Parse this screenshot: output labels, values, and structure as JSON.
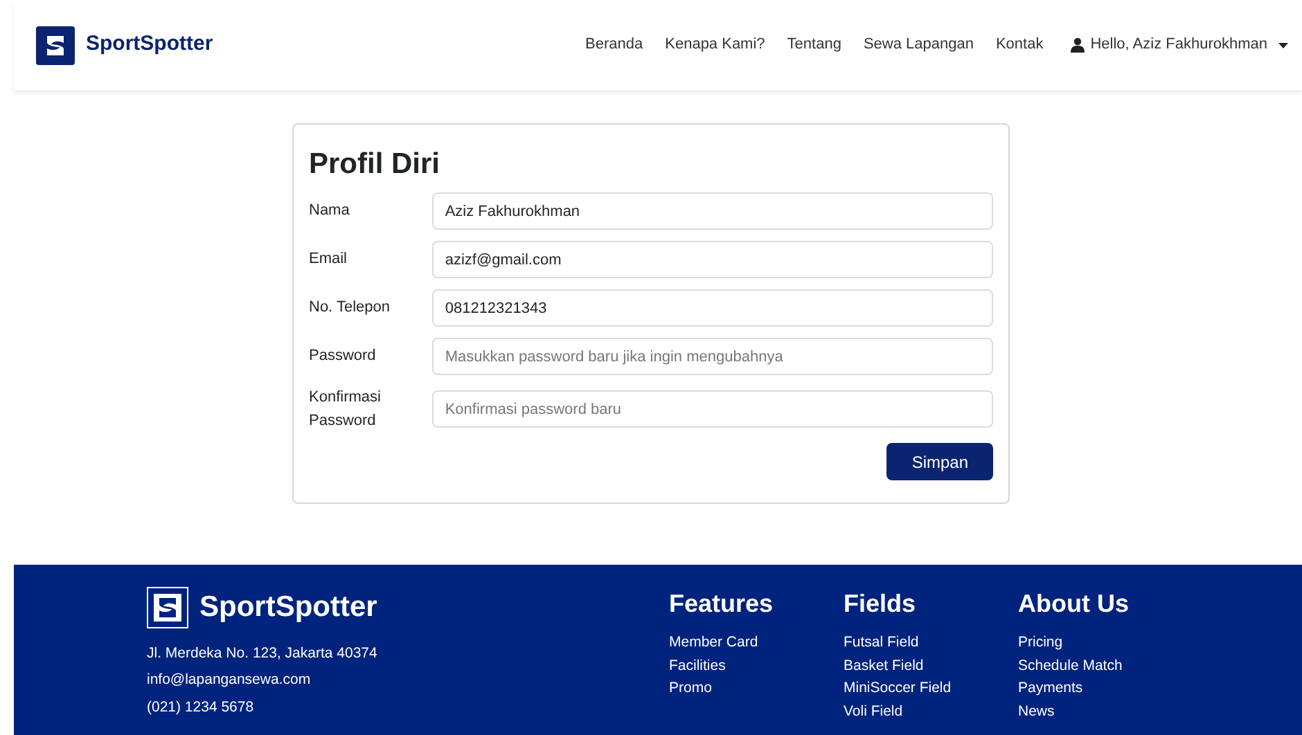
{
  "navbar": {
    "brand": "SportSpotter",
    "links": [
      "Beranda",
      "Kenapa Kami?",
      "Tentang",
      "Sewa Lapangan",
      "Kontak"
    ],
    "user_menu": "Hello, Aziz Fakhurokhman"
  },
  "profile": {
    "title": "Profil Diri",
    "fields": [
      {
        "label": "Nama",
        "value": "Aziz Fakhurokhman"
      },
      {
        "label": "Email",
        "value": "azizf@gmail.com"
      },
      {
        "label": "No. Telepon",
        "value": "081212321343"
      },
      {
        "label": "Password",
        "placeholder": "Masukkan password baru jika ingin mengubahnya"
      },
      {
        "label": "Konfirmasi Password",
        "placeholder": "Konfirmasi password baru"
      }
    ],
    "submit": "Simpan"
  },
  "footer": {
    "brand": "SportSpotter",
    "contact": [
      "Jl. Merdeka No. 123, Jakarta 40374",
      "info@lapangansewa.com",
      "(021) 1234 5678"
    ],
    "columns": [
      {
        "title": "Features",
        "links": [
          "Member Card",
          "Facilities",
          "Promo"
        ]
      },
      {
        "title": "Fields",
        "links": [
          "Futsal Field",
          "Basket Field",
          "MiniSoccer Field",
          "Voli Field"
        ]
      },
      {
        "title": "About Us",
        "links": [
          "Pricing",
          "Schedule Match",
          "Payments",
          "News"
        ]
      }
    ]
  }
}
